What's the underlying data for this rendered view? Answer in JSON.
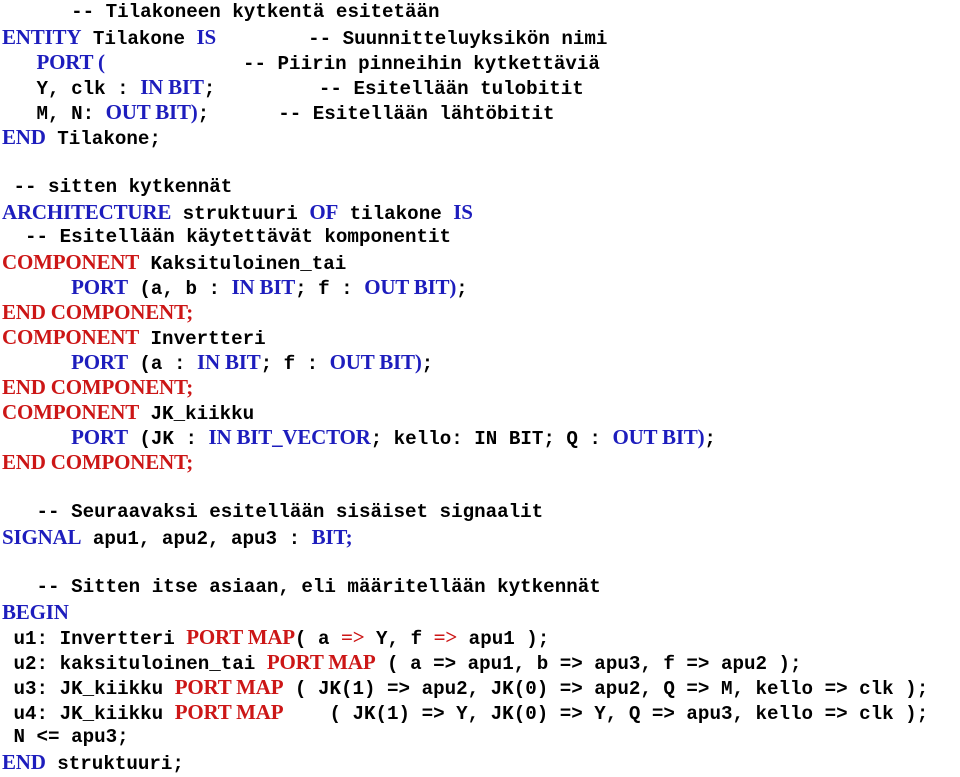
{
  "colors": {
    "background": "#ffffff",
    "plain_text": "#000000",
    "keyword_blue": "#1d1dbd",
    "keyword_red": "#cc1616"
  },
  "listing": {
    "language": "VHDL",
    "lines": [
      {
        "id": "line-1",
        "tokens": [
          {
            "kind": "plain",
            "text": "      "
          },
          {
            "kind": "comment",
            "text": "-- Tilakoneen kytkentä esitetään"
          }
        ]
      },
      {
        "id": "line-2",
        "tokens": [
          {
            "kind": "kw",
            "text": "ENTITY"
          },
          {
            "kind": "plain",
            "text": " Tilakone "
          },
          {
            "kind": "kw",
            "text": "IS"
          },
          {
            "kind": "plain",
            "text": "        "
          },
          {
            "kind": "comment",
            "text": "-- Suunnitteluyksikön nimi"
          }
        ]
      },
      {
        "id": "line-3",
        "tokens": [
          {
            "kind": "plain",
            "text": "   "
          },
          {
            "kind": "kw",
            "text": "PORT ("
          },
          {
            "kind": "plain",
            "text": "            "
          },
          {
            "kind": "comment",
            "text": "-- Piirin pinneihin kytkettäviä"
          }
        ]
      },
      {
        "id": "line-4",
        "tokens": [
          {
            "kind": "plain",
            "text": "   Y, clk : "
          },
          {
            "kind": "kw",
            "text": "IN BIT"
          },
          {
            "kind": "plain",
            "text": ";"
          },
          {
            "kind": "plain",
            "text": "         "
          },
          {
            "kind": "comment",
            "text": "-- Esitellään tulobitit"
          }
        ]
      },
      {
        "id": "line-5",
        "tokens": [
          {
            "kind": "plain",
            "text": "   M, N: "
          },
          {
            "kind": "kw",
            "text": "OUT BIT)"
          },
          {
            "kind": "plain",
            "text": ";"
          },
          {
            "kind": "plain",
            "text": "      "
          },
          {
            "kind": "comment",
            "text": "-- Esitellään lähtöbitit"
          }
        ]
      },
      {
        "id": "line-6",
        "tokens": [
          {
            "kind": "kw",
            "text": "END"
          },
          {
            "kind": "plain",
            "text": " Tilakone;"
          }
        ]
      },
      {
        "id": "line-7",
        "tokens": []
      },
      {
        "id": "line-8",
        "tokens": [
          {
            "kind": "plain",
            "text": " "
          },
          {
            "kind": "comment",
            "text": "-- sitten kytkennät"
          }
        ]
      },
      {
        "id": "line-9",
        "tokens": [
          {
            "kind": "kw",
            "text": "ARCHITECTURE"
          },
          {
            "kind": "plain",
            "text": " struktuuri "
          },
          {
            "kind": "kw",
            "text": "OF"
          },
          {
            "kind": "plain",
            "text": " tilakone "
          },
          {
            "kind": "kw",
            "text": "IS"
          }
        ]
      },
      {
        "id": "line-10",
        "tokens": [
          {
            "kind": "plain",
            "text": "  "
          },
          {
            "kind": "comment",
            "text": "-- Esitellään käytettävät komponentit"
          }
        ]
      },
      {
        "id": "line-11",
        "tokens": [
          {
            "kind": "kw-red",
            "text": "COMPONENT"
          },
          {
            "kind": "plain",
            "text": " Kaksituloinen_tai"
          }
        ]
      },
      {
        "id": "line-12",
        "tokens": [
          {
            "kind": "plain",
            "text": "      "
          },
          {
            "kind": "kw",
            "text": "PORT"
          },
          {
            "kind": "plain",
            "text": " (a, b : "
          },
          {
            "kind": "kw",
            "text": "IN BIT"
          },
          {
            "kind": "plain",
            "text": "; f : "
          },
          {
            "kind": "kw",
            "text": "OUT BIT)"
          },
          {
            "kind": "plain",
            "text": ";"
          }
        ]
      },
      {
        "id": "line-13",
        "tokens": [
          {
            "kind": "kw-red",
            "text": "END COMPONENT;"
          }
        ]
      },
      {
        "id": "line-14",
        "tokens": [
          {
            "kind": "kw-red",
            "text": "COMPONENT"
          },
          {
            "kind": "plain",
            "text": " Invertteri"
          }
        ]
      },
      {
        "id": "line-15",
        "tokens": [
          {
            "kind": "plain",
            "text": "      "
          },
          {
            "kind": "kw",
            "text": "PORT"
          },
          {
            "kind": "plain",
            "text": " (a : "
          },
          {
            "kind": "kw",
            "text": "IN BIT"
          },
          {
            "kind": "plain",
            "text": "; f : "
          },
          {
            "kind": "kw",
            "text": "OUT BIT)"
          },
          {
            "kind": "plain",
            "text": ";"
          }
        ]
      },
      {
        "id": "line-16",
        "tokens": [
          {
            "kind": "kw-red",
            "text": "END COMPONENT;"
          }
        ]
      },
      {
        "id": "line-17",
        "tokens": [
          {
            "kind": "kw-red",
            "text": "COMPONENT"
          },
          {
            "kind": "plain",
            "text": " JK_kiikku"
          }
        ]
      },
      {
        "id": "line-18",
        "tokens": [
          {
            "kind": "plain",
            "text": "      "
          },
          {
            "kind": "kw",
            "text": "PORT"
          },
          {
            "kind": "plain",
            "text": " (JK : "
          },
          {
            "kind": "kw",
            "text": "IN BIT_VECTOR"
          },
          {
            "kind": "plain",
            "text": "; kello: IN BIT; Q : "
          },
          {
            "kind": "kw",
            "text": "OUT BIT)"
          },
          {
            "kind": "plain",
            "text": ";"
          }
        ]
      },
      {
        "id": "line-19",
        "tokens": [
          {
            "kind": "kw-red",
            "text": "END COMPONENT;"
          }
        ]
      },
      {
        "id": "line-20",
        "tokens": []
      },
      {
        "id": "line-21",
        "tokens": [
          {
            "kind": "plain",
            "text": "   "
          },
          {
            "kind": "comment",
            "text": "-- Seuraavaksi esitellään sisäiset signaalit"
          }
        ]
      },
      {
        "id": "line-22",
        "tokens": [
          {
            "kind": "kw",
            "text": "SIGNAL"
          },
          {
            "kind": "plain",
            "text": " apu1, apu2, apu3 : "
          },
          {
            "kind": "kw",
            "text": "BIT;"
          }
        ]
      },
      {
        "id": "line-23",
        "tokens": []
      },
      {
        "id": "line-24",
        "tokens": [
          {
            "kind": "plain",
            "text": "   "
          },
          {
            "kind": "comment",
            "text": "-- Sitten itse asiaan, eli määritellään kytkennät"
          }
        ]
      },
      {
        "id": "line-25",
        "tokens": [
          {
            "kind": "kw",
            "text": "BEGIN"
          }
        ]
      },
      {
        "id": "line-26",
        "tokens": [
          {
            "kind": "plain",
            "text": " u1: Invertteri "
          },
          {
            "kind": "kw-red",
            "text": "PORT MAP"
          },
          {
            "kind": "plain",
            "text": "( a "
          },
          {
            "kind": "kw-red",
            "text": "=>"
          },
          {
            "kind": "plain",
            "text": " Y, f "
          },
          {
            "kind": "kw-red",
            "text": "=>"
          },
          {
            "kind": "plain",
            "text": " apu1 );"
          }
        ]
      },
      {
        "id": "line-27",
        "tokens": [
          {
            "kind": "plain",
            "text": " u2: kaksituloinen_tai "
          },
          {
            "kind": "kw-red",
            "text": "PORT MAP"
          },
          {
            "kind": "plain",
            "text": " ( a => apu1, b => apu3, f => apu2 );"
          }
        ]
      },
      {
        "id": "line-28",
        "tokens": [
          {
            "kind": "plain",
            "text": " u3: JK_kiikku "
          },
          {
            "kind": "kw-red",
            "text": "PORT MAP"
          },
          {
            "kind": "plain",
            "text": " ( JK(1) => apu2, JK(0) => apu2, Q => M, kello => clk );"
          }
        ]
      },
      {
        "id": "line-29",
        "tokens": [
          {
            "kind": "plain",
            "text": " u4: JK_kiikku "
          },
          {
            "kind": "kw-red",
            "text": "PORT MAP"
          },
          {
            "kind": "plain",
            "text": "    ( JK(1) => Y, JK(0) => Y, Q => apu3, kello => clk );"
          }
        ]
      },
      {
        "id": "line-30",
        "tokens": [
          {
            "kind": "plain",
            "text": " N <= apu3;"
          }
        ]
      },
      {
        "id": "line-31",
        "tokens": [
          {
            "kind": "kw",
            "text": "END"
          },
          {
            "kind": "plain",
            "text": " struktuuri;"
          }
        ]
      }
    ]
  }
}
